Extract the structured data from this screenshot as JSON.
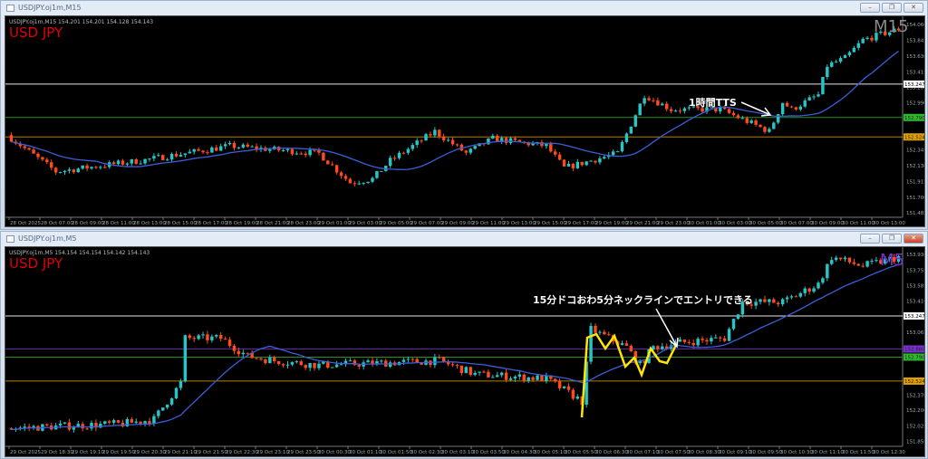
{
  "top_window": {
    "title": "USDJPY.oj1m,M15",
    "header": "USDJPY.oj1m,M15  154.201 154.201 154.128 154.143",
    "symbol": "USD JPY",
    "timeframe": "M15",
    "timeframe_color": "#8a8a8a",
    "annotation": "1時間TTS"
  },
  "bottom_window": {
    "title": "USDJPY.oj1m,M5",
    "header": "USDJPY.oj1m,M5  154.154 154.154 154.142 154.143",
    "symbol": "USD JPY",
    "timeframe": "M5",
    "timeframe_color": "#7a2fd0",
    "annotation": "15分ドコおわ5分ネックラインでエントリできる"
  },
  "window_buttons": {
    "minimize": "–",
    "restore": "❐",
    "close": "✕"
  },
  "colors": {
    "bull": "#26c6c6",
    "bear": "#ff4a1a",
    "ma": "#3a5fd8",
    "zigzag": "#ffe600"
  },
  "chart_data": [
    {
      "type": "candlestick",
      "title": "USDJPY.oj1m,M15",
      "bars": 200,
      "price_path": [
        [
          0,
          152.55
        ],
        [
          11,
          152.05
        ],
        [
          30,
          152.2
        ],
        [
          50,
          152.4
        ],
        [
          70,
          152.3
        ],
        [
          77,
          151.9
        ],
        [
          82,
          151.95
        ],
        [
          86,
          152.2
        ],
        [
          96,
          152.6
        ],
        [
          103,
          152.3
        ],
        [
          109,
          152.5
        ],
        [
          121,
          152.4
        ],
        [
          125,
          152.1
        ],
        [
          137,
          152.3
        ],
        [
          143,
          153.1
        ],
        [
          149,
          152.9
        ],
        [
          160,
          152.9
        ],
        [
          171,
          152.6
        ],
        [
          174,
          153.0
        ],
        [
          176,
          152.9
        ],
        [
          182,
          153.1
        ],
        [
          184,
          153.5
        ],
        [
          188,
          153.6
        ],
        [
          192,
          153.85
        ],
        [
          200,
          154.0
        ]
      ],
      "ma_period": 20,
      "ylim": [
        151.45,
        154.1
      ],
      "y_ticks": [
        "154.060",
        "153.845",
        "153.630",
        "153.415",
        "153.200",
        "152.990",
        "152.345",
        "152.130",
        "151.915",
        "151.700",
        "151.485"
      ],
      "x_ticks": [
        "28 Oct 2025",
        "28 Oct 07:00",
        "28 Oct 09:00",
        "28 Oct 11:00",
        "28 Oct 13:00",
        "28 Oct 15:00",
        "28 Oct 17:00",
        "28 Oct 19:00",
        "28 Oct 21:00",
        "28 Oct 23:00",
        "29 Oct 01:00",
        "29 Oct 03:00",
        "29 Oct 05:00",
        "29 Oct 07:00",
        "29 Oct 09:00",
        "29 Oct 11:00",
        "29 Oct 13:00",
        "29 Oct 15:00",
        "29 Oct 17:00",
        "29 Oct 19:00",
        "29 Oct 21:00",
        "29 Oct 23:00",
        "30 Oct 01:00",
        "30 Oct 03:00",
        "30 Oct 05:00",
        "30 Oct 07:00",
        "30 Oct 09:00",
        "30 Oct 11:00",
        "30 Oct 13:00"
      ],
      "hlines": [
        {
          "price": 153.247,
          "label": "153.247",
          "color": "#ffffff"
        },
        {
          "price": 152.79,
          "label": "152.790",
          "color": "#2db82d"
        },
        {
          "price": 152.524,
          "label": "152.524",
          "color": "#e0a000"
        }
      ]
    },
    {
      "type": "candlestick",
      "title": "USDJPY.oj1m,M5",
      "bars": 200,
      "price_path": [
        [
          0,
          152.0
        ],
        [
          26,
          152.05
        ],
        [
          33,
          152.1
        ],
        [
          39,
          152.5
        ],
        [
          40,
          153.0
        ],
        [
          48,
          153.0
        ],
        [
          54,
          152.8
        ],
        [
          60,
          152.75
        ],
        [
          70,
          152.7
        ],
        [
          97,
          152.75
        ],
        [
          105,
          152.6
        ],
        [
          121,
          152.55
        ],
        [
          129,
          152.3
        ],
        [
          131,
          153.1
        ],
        [
          139,
          152.9
        ],
        [
          142,
          152.7
        ],
        [
          145,
          152.9
        ],
        [
          151,
          152.95
        ],
        [
          161,
          153.0
        ],
        [
          165,
          153.4
        ],
        [
          174,
          153.4
        ],
        [
          182,
          153.6
        ],
        [
          185,
          153.9
        ],
        [
          192,
          153.8
        ],
        [
          200,
          153.9
        ]
      ],
      "ma_period": 20,
      "ylim": [
        151.82,
        153.95
      ],
      "y_ticks": [
        "153.930",
        "153.755",
        "153.585",
        "153.410",
        "153.065",
        "152.370",
        "152.200",
        "152.025",
        "151.855"
      ],
      "x_ticks": [
        "29 Oct 2025",
        "29 Oct 18:30",
        "29 Oct 19:10",
        "29 Oct 19:50",
        "29 Oct 20:30",
        "29 Oct 21:10",
        "29 Oct 21:50",
        "29 Oct 22:30",
        "29 Oct 23:10",
        "29 Oct 23:50",
        "30 Oct 00:30",
        "30 Oct 01:10",
        "30 Oct 01:50",
        "30 Oct 02:30",
        "30 Oct 03:10",
        "30 Oct 03:50",
        "30 Oct 04:30",
        "30 Oct 05:10",
        "30 Oct 05:50",
        "30 Oct 06:30",
        "30 Oct 07:10",
        "30 Oct 07:50",
        "30 Oct 08:30",
        "30 Oct 09:10",
        "30 Oct 09:50",
        "30 Oct 10:30",
        "30 Oct 11:10",
        "30 Oct 11:50",
        "30 Oct 12:30"
      ],
      "hlines": [
        {
          "price": 153.247,
          "label": "153.247",
          "color": "#ffffff"
        },
        {
          "price": 152.88,
          "label": "152.880",
          "color": "#7a2fd0"
        },
        {
          "price": 152.79,
          "label": "152.790",
          "color": "#2db82d"
        },
        {
          "price": 152.524,
          "label": "152.524",
          "color": "#e0a000"
        }
      ]
    }
  ]
}
